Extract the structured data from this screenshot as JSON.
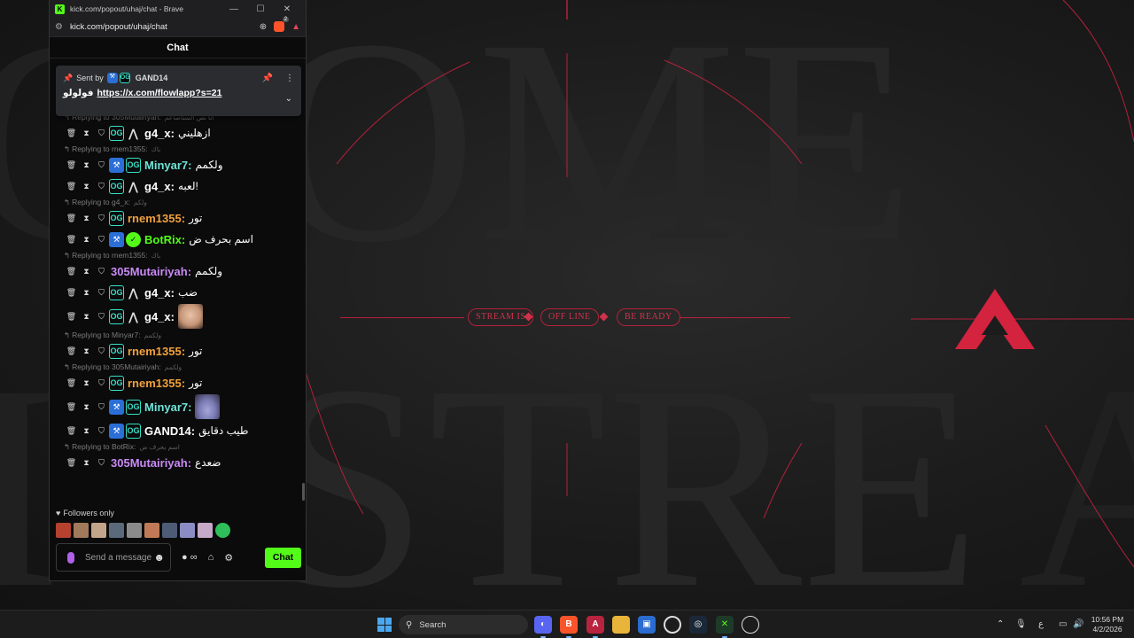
{
  "window": {
    "title": "kick.com/popout/uhaj/chat - Brave",
    "url": "kick.com/popout/uhaj/chat",
    "brave_badge_count": "2"
  },
  "chat": {
    "header": "Chat",
    "pinned": {
      "sent_by_label": "Sent by",
      "sender": "GAND14",
      "prefix_text": "فولولو",
      "link": "https://x.com/flowlapp?s=21"
    },
    "messages": [
      {
        "reply": "Replying to 305Mutairiyah:",
        "reply_text": "اتا نص الستاصاعم",
        "user": "g4_x",
        "text": "ازهليني",
        "color": "#ffffff"
      },
      {
        "reply": "Replying to rnem1355:",
        "reply_text": "باك",
        "user": "Minyar7",
        "text": "ولكمم",
        "color": "#6fe3d8"
      },
      {
        "reply": "",
        "reply_text": "",
        "user": "g4_x",
        "text": "لعبه!",
        "color": "#ffffff"
      },
      {
        "reply": "Replying to g4_x:",
        "reply_text": "ولكم",
        "user": "rnem1355",
        "text": "تور",
        "color": "#f2a13b"
      },
      {
        "reply": "",
        "reply_text": "",
        "user": "BotRix",
        "text": "اسم بحرف ض",
        "color": "#53fc18"
      },
      {
        "reply": "Replying to rnem1355:",
        "reply_text": "باك",
        "user": "305Mutairiyah",
        "text": "ولكمم",
        "color": "#c98af5"
      },
      {
        "reply": "",
        "reply_text": "",
        "user": "g4_x",
        "text": "ضب",
        "color": "#ffffff"
      },
      {
        "reply": "",
        "reply_text": "",
        "user": "g4_x",
        "text": "",
        "color": "#ffffff",
        "emote": "baby-emote"
      },
      {
        "reply": "Replying to Minyar7:",
        "reply_text": "ولكمم",
        "user": "rnem1355",
        "text": "تور",
        "color": "#f2a13b"
      },
      {
        "reply": "Replying to 305Mutairiyah:",
        "reply_text": "ولكمم",
        "user": "rnem1355",
        "text": "تور",
        "color": "#f2a13b"
      },
      {
        "reply": "",
        "reply_text": "",
        "user": "Minyar7",
        "text": "",
        "color": "#6fe3d8",
        "emote": "blob-emote"
      },
      {
        "reply": "",
        "reply_text": "",
        "user": "GAND14",
        "text": "طيب دقايق",
        "color": "#ffffff"
      },
      {
        "reply": "Replying to BotRix:",
        "reply_text": "اسم بحرف ض",
        "user": "305Mutairiyah",
        "text": "ضعدع",
        "color": "#c98af5"
      }
    ],
    "followers_only": "Followers only",
    "input_placeholder": "Send a message",
    "send_button": "Chat",
    "infinity_label": "∞"
  },
  "stream_offline": {
    "pills": [
      "STREAM IS",
      "OFF LINE",
      "BE READY"
    ],
    "accent": "#d0324b"
  },
  "taskbar": {
    "search_label": "Search",
    "time": "10:56 PM",
    "date": "4/2/2026",
    "lang": "ع"
  },
  "colors": {
    "kick_green": "#53fc18",
    "og_badge": "#35e0c8"
  }
}
